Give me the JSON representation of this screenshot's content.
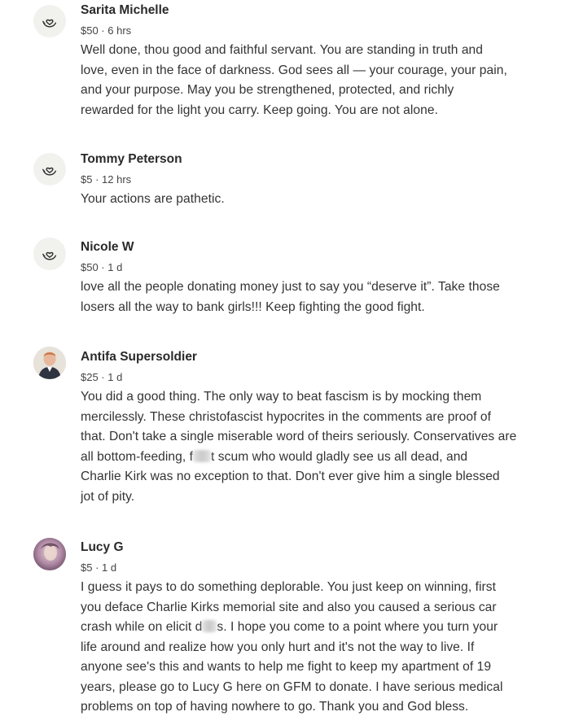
{
  "comments": [
    {
      "name": "Sarita Michelle",
      "meta": "$50 · 6 hrs",
      "avatar": "heart-hand-icon",
      "lines": [
        "Well done, thou good and faithful servant. You are standing in truth and",
        "love, even in the face of darkness. God sees all — your courage, your pain,",
        "and your purpose. May you be strengthened, protected, and richly",
        "rewarded for the light you carry. Keep going. You are not alone."
      ]
    },
    {
      "name": "Tommy Peterson",
      "meta": "$5 · 12 hrs",
      "avatar": "heart-hand-icon",
      "lines": [
        "Your actions are pathetic."
      ]
    },
    {
      "name": "Nicole W",
      "meta": "$50 · 1 d",
      "avatar": "heart-hand-icon",
      "lines": [
        "love all the people donating money just to say you “deserve it”. Take those",
        "losers all the way to bank girls!!! Keep fighting the good fight."
      ]
    },
    {
      "name": "Antifa Supersoldier",
      "meta": "$25 · 1 d",
      "avatar": "profile-photo",
      "lines": [
        "You did a good thing. The only way to beat fascism is by mocking them",
        "mercilessly. These christofascist hypocrites in the comments are proof of",
        "that. Don't take a single miserable word of theirs seriously. Conservatives are",
        "all bottom-feeding, f",
        "t scum who would gladly see us all dead, and",
        "Charlie Kirk was no exception to that. Don't ever give him a single blessed",
        "jot of pity."
      ]
    },
    {
      "name": "Lucy G",
      "meta": "$5 · 1 d",
      "avatar": "profile-photo",
      "lines": [
        "I guess it pays to do something deplorable. You just keep on winning, first",
        "you deface Charlie Kirks memorial site and also you caused a serious car",
        "crash while on elicit d",
        "s. I hope you come to a point where you turn your",
        "life around and realize how you only hurt and it's not the way to live. If",
        "anyone see's this and wants to help me fight to keep my apartment of 19",
        "years, please go to Lucy G here on GFM to donate. I have serious medical",
        "problems on top of having nowhere to go. Thank you and God bless."
      ]
    }
  ]
}
